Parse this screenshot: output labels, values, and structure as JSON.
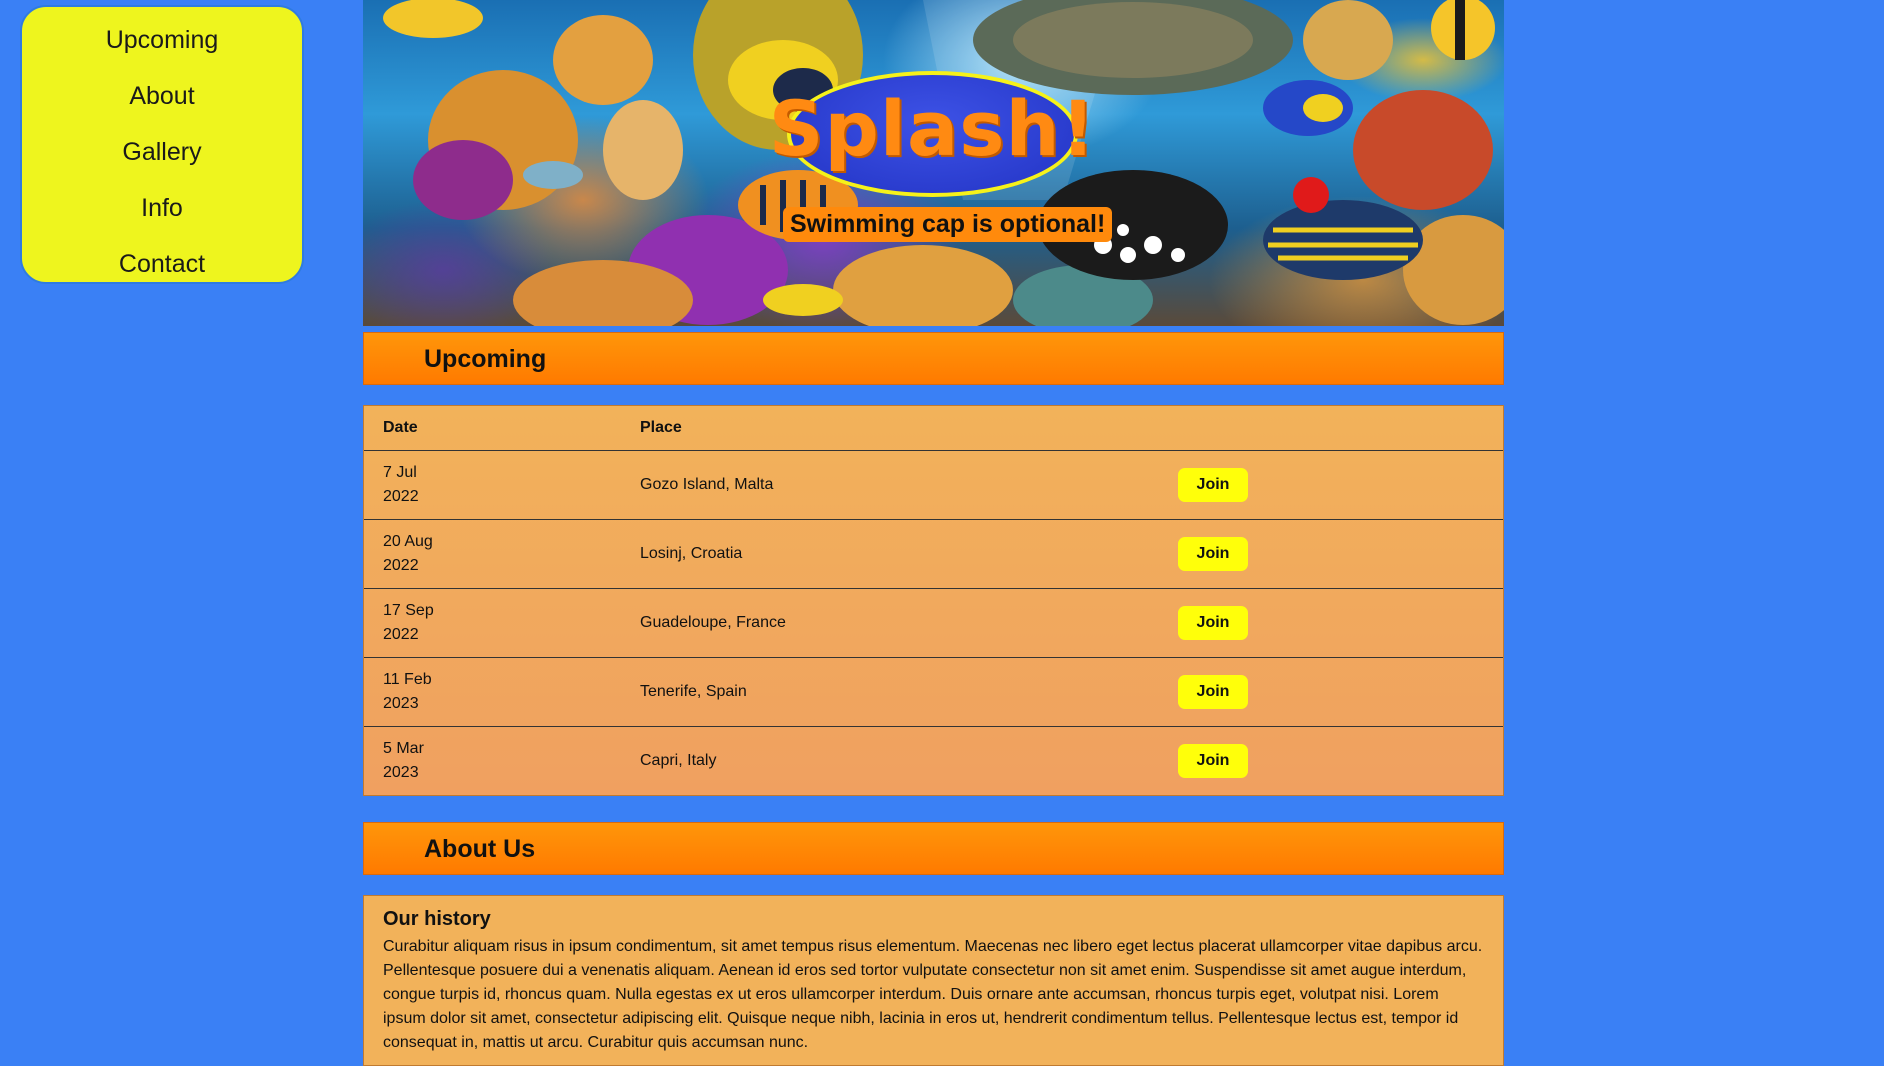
{
  "nav": {
    "items": [
      {
        "label": "Upcoming"
      },
      {
        "label": "About"
      },
      {
        "label": "Gallery"
      },
      {
        "label": "Info"
      },
      {
        "label": "Contact"
      }
    ]
  },
  "hero": {
    "logo_text": "Splash!",
    "tagline": "Swimming cap is optional!",
    "image_description_icon": "coral-reef-fish-image"
  },
  "upcoming": {
    "heading": "Upcoming",
    "columns": {
      "date": "Date",
      "place": "Place"
    },
    "rows": [
      {
        "date_day": "7 Jul",
        "date_year": "2022",
        "place": "Gozo Island, Malta",
        "action": "Join"
      },
      {
        "date_day": "20 Aug",
        "date_year": "2022",
        "place": "Losinj, Croatia",
        "action": "Join"
      },
      {
        "date_day": "17 Sep",
        "date_year": "2022",
        "place": "Guadeloupe, France",
        "action": "Join"
      },
      {
        "date_day": "11 Feb",
        "date_year": "2023",
        "place": "Tenerife, Spain",
        "action": "Join"
      },
      {
        "date_day": "5 Mar",
        "date_year": "2023",
        "place": "Capri, Italy",
        "action": "Join"
      }
    ]
  },
  "about": {
    "heading": "About Us",
    "subheading": "Our history",
    "body": "Curabitur aliquam risus in ipsum condimentum, sit amet tempus risus elementum. Maecenas nec libero eget lectus placerat ullamcorper vitae dapibus arcu. Pellentesque posuere dui a venenatis aliquam. Aenean id eros sed tortor vulputate consectetur non sit amet enim. Suspendisse sit amet augue interdum, congue turpis id, rhoncus quam. Nulla egestas ex ut eros ullamcorper interdum. Duis ornare ante accumsan, rhoncus turpis eget, volutpat nisi. Lorem ipsum dolor sit amet, consectetur adipiscing elit. Quisque neque nibh, lacinia in eros ut, hendrerit condimentum tellus. Pellentesque lectus est, tempor id consequat in, mattis ut arcu. Curabitur quis accumsan nunc."
  },
  "colors": {
    "page_background": "#3a80f5",
    "nav_background": "#eef51e",
    "section_bar": "#ff8a0a",
    "table_background": "#f2b25a",
    "join_button": "#ffff0a",
    "logo_oval": "#2e3fd8",
    "logo_text": "#ff8a12"
  }
}
